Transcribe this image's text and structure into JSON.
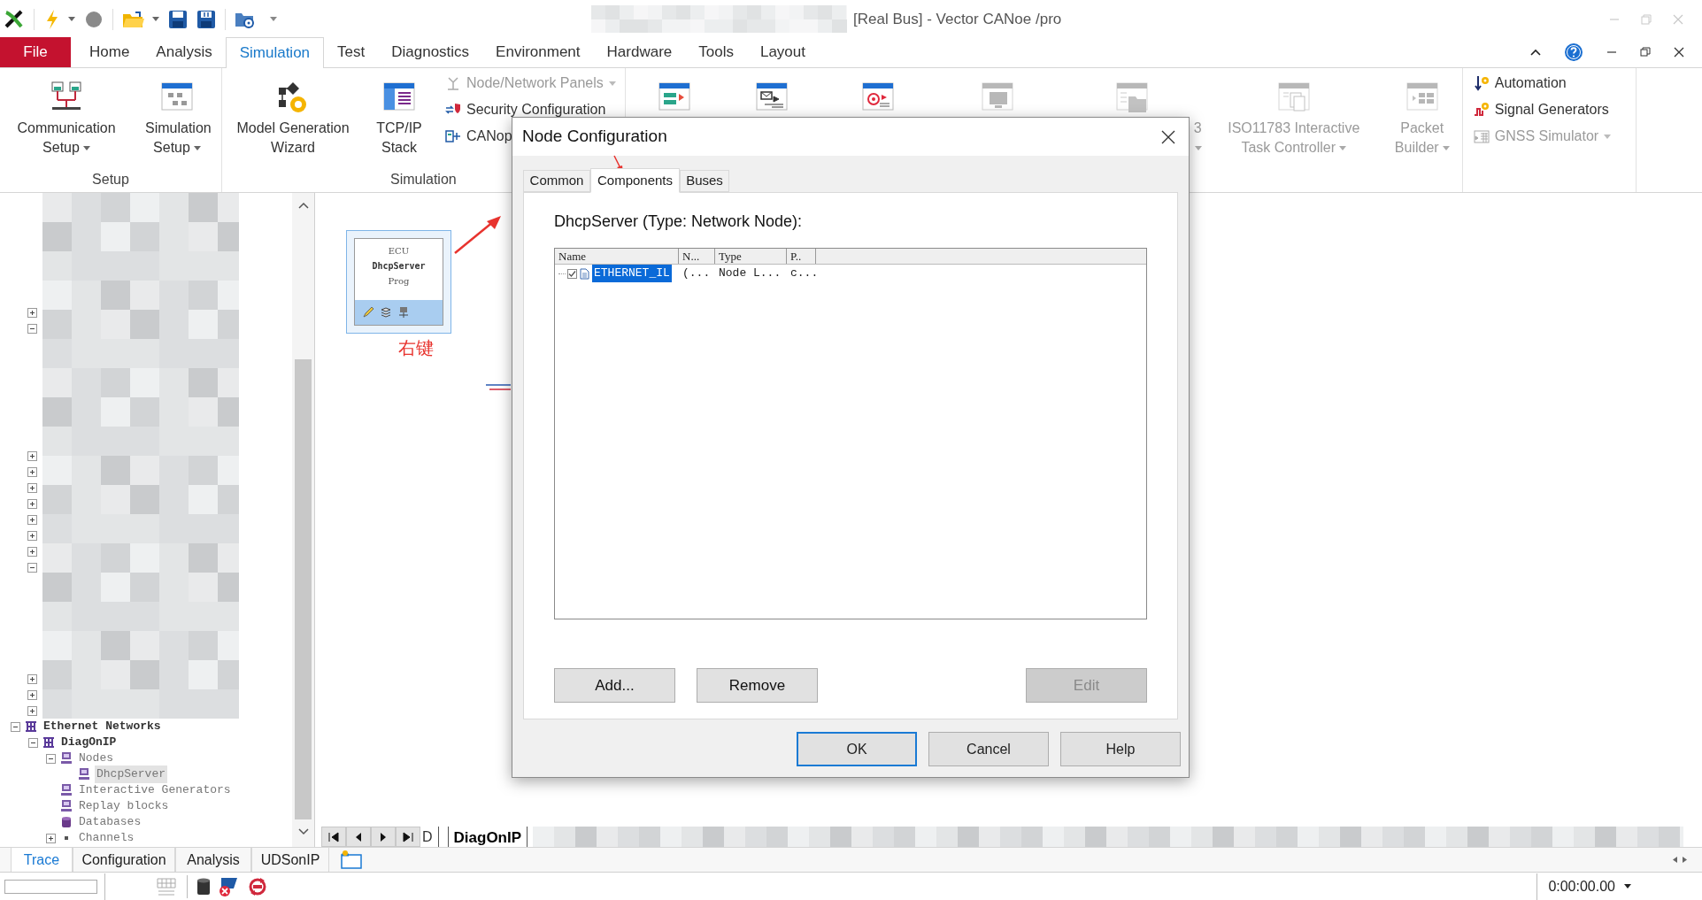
{
  "window": {
    "title": "[Real Bus] - Vector CANoe /pro"
  },
  "ribbon_tabs": [
    {
      "label": "File",
      "kind": "file",
      "selected": false
    },
    {
      "label": "Home",
      "kind": "tab",
      "selected": false
    },
    {
      "label": "Analysis",
      "kind": "tab",
      "selected": false
    },
    {
      "label": "Simulation",
      "kind": "tab",
      "selected": true
    },
    {
      "label": "Test",
      "kind": "tab",
      "selected": false
    },
    {
      "label": "Diagnostics",
      "kind": "tab",
      "selected": false
    },
    {
      "label": "Environment",
      "kind": "tab",
      "selected": false
    },
    {
      "label": "Hardware",
      "kind": "tab",
      "selected": false
    },
    {
      "label": "Tools",
      "kind": "tab",
      "selected": false
    },
    {
      "label": "Layout",
      "kind": "tab",
      "selected": false
    }
  ],
  "ribbon": {
    "groups": [
      {
        "label": "Setup",
        "items": [
          {
            "kind": "large",
            "label": "Communication Setup",
            "dropdown": true,
            "disabled": false
          },
          {
            "kind": "large",
            "label": "Simulation Setup",
            "dropdown": true,
            "disabled": false
          }
        ]
      },
      {
        "label": "Simulation",
        "items": [
          {
            "kind": "large",
            "label": "Model Generation Wizard",
            "dropdown": false,
            "disabled": false
          },
          {
            "kind": "large",
            "label": "TCP/IP Stack",
            "dropdown": false,
            "disabled": false
          },
          {
            "kind": "small",
            "label": "Node/Network Panels",
            "dropdown": true,
            "disabled": true
          },
          {
            "kind": "small",
            "label": "Security Configuration",
            "dropdown": false,
            "disabled": false
          },
          {
            "kind": "small",
            "label": "CANop",
            "dropdown": false,
            "disabled": false
          }
        ]
      },
      {
        "items": [
          {
            "kind": "large",
            "disabled": false
          },
          {
            "kind": "large",
            "disabled": false
          },
          {
            "kind": "large",
            "disabled": false
          },
          {
            "kind": "large",
            "disabled": true
          },
          {
            "kind": "cut",
            "label": "3",
            "dropdown": true,
            "disabled": true
          },
          {
            "kind": "large",
            "label": "ISO11783 Interactive Task Controller",
            "dropdown": true,
            "disabled": true
          },
          {
            "kind": "large",
            "label": "Packet Builder",
            "dropdown": true,
            "disabled": true
          }
        ]
      },
      {
        "items": [
          {
            "kind": "small",
            "label": "Automation",
            "dropdown": false,
            "disabled": false
          },
          {
            "kind": "small",
            "label": "Signal Generators",
            "dropdown": false,
            "disabled": false
          },
          {
            "kind": "small",
            "label": "GNSS Simulator",
            "dropdown": true,
            "disabled": true
          }
        ]
      }
    ]
  },
  "tree": {
    "hidden_items": [
      {
        "expanded": false
      },
      {
        "expanded": true
      },
      {
        "expanded": false
      },
      {
        "expanded": false
      },
      {
        "expanded": false
      },
      {
        "expanded": false
      },
      {
        "expanded": false
      },
      {
        "expanded": false
      },
      {
        "expanded": false
      },
      {
        "expanded": true
      },
      {
        "expanded": false
      },
      {
        "expanded": false
      },
      {
        "expanded": false
      }
    ],
    "items": [
      {
        "label": "Ethernet Networks",
        "kind": "network",
        "expanded": true,
        "selected": false,
        "children": [
          {
            "label": "DiagOnIP",
            "kind": "network",
            "expanded": true,
            "selected": false,
            "children": [
              {
                "label": "Nodes",
                "kind": "node",
                "expanded": true,
                "selected": false,
                "children": [
                  {
                    "label": "DhcpServer",
                    "kind": "node",
                    "selected": true
                  }
                ]
              },
              {
                "label": "Interactive Generators",
                "kind": "node",
                "selected": false
              },
              {
                "label": "Replay blocks",
                "kind": "node",
                "selected": false
              },
              {
                "label": "Databases",
                "kind": "database",
                "selected": false
              },
              {
                "label": "Channels",
                "kind": "channel",
                "expanded": false,
                "selected": false
              }
            ]
          }
        ]
      }
    ]
  },
  "canvas": {
    "node": {
      "title": "ECU",
      "name": "DhcpServer",
      "subtitle": "Prog"
    },
    "annotation": "右键",
    "tabs": [
      {
        "label": "D",
        "selected": false
      },
      {
        "label": "DiagOnIP",
        "selected": true
      }
    ]
  },
  "dialog": {
    "title": "Node Configuration",
    "tabs": [
      {
        "label": "Common",
        "selected": false
      },
      {
        "label": "Components",
        "selected": true
      },
      {
        "label": "Buses",
        "selected": false
      }
    ],
    "heading": "DhcpServer (Type: Network Node):",
    "list": {
      "columns": [
        "Name",
        "N...",
        "Type",
        "P.."
      ],
      "rows": [
        {
          "checked": true,
          "selected": true,
          "cells": [
            "ETHERNET_IL",
            "(...",
            "Node L...",
            "c..."
          ]
        }
      ]
    },
    "buttons": [
      {
        "label": "Add...",
        "disabled": false
      },
      {
        "label": "Remove",
        "disabled": false
      },
      {
        "label": "Edit",
        "disabled": true
      }
    ],
    "footer_buttons": [
      {
        "label": "OK",
        "default": true
      },
      {
        "label": "Cancel",
        "default": false
      },
      {
        "label": "Help",
        "default": false
      }
    ]
  },
  "bottom_tabs": [
    {
      "label": "Trace",
      "selected": true
    },
    {
      "label": "Configuration",
      "selected": false
    },
    {
      "label": "Analysis",
      "selected": false
    },
    {
      "label": "UDSonIP",
      "selected": false
    }
  ],
  "status_bar": {
    "time": "0:00:00.00"
  }
}
